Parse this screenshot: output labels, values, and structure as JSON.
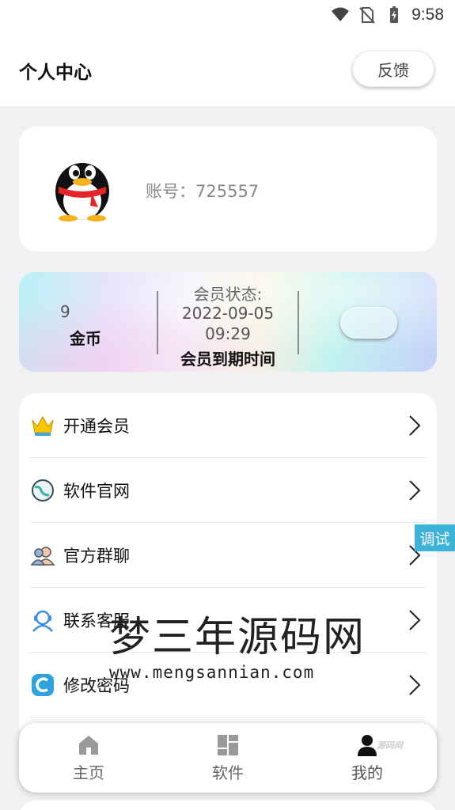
{
  "status_bar": {
    "time": "9:58",
    "icons": [
      "wifi-icon",
      "no-sim-icon",
      "battery-charging-icon"
    ]
  },
  "header": {
    "title": "个人中心",
    "feedback_label": "反馈"
  },
  "profile": {
    "avatar_icon": "qq-penguin-icon",
    "account_text": "账号：725557"
  },
  "member": {
    "coins_value": "9",
    "coins_label": "金币",
    "status_label": "会员状态:",
    "expire_date": "2022-09-05",
    "expire_time": "09:29",
    "expire_label": "会员到期时间"
  },
  "menu": {
    "items": [
      {
        "label": "开通会员",
        "icon": "crown-icon"
      },
      {
        "label": "软件官网",
        "icon": "globe-icon"
      },
      {
        "label": "官方群聊",
        "icon": "group-icon"
      },
      {
        "label": "联系客服",
        "icon": "customer-service-icon"
      },
      {
        "label": "修改密码",
        "icon": "edit-password-icon"
      }
    ]
  },
  "debug_tag": "调试",
  "watermark": {
    "title": "梦三年源码网",
    "url": "www.mengsannian.com",
    "small": "源码网"
  },
  "bottom_nav": {
    "items": [
      {
        "label": "主页",
        "icon": "home-icon"
      },
      {
        "label": "软件",
        "icon": "apps-icon"
      },
      {
        "label": "我的",
        "icon": "user-icon"
      }
    ]
  },
  "colors": {
    "accent": "#3db3d9",
    "background": "#f1f1f3",
    "card": "#ffffff"
  }
}
